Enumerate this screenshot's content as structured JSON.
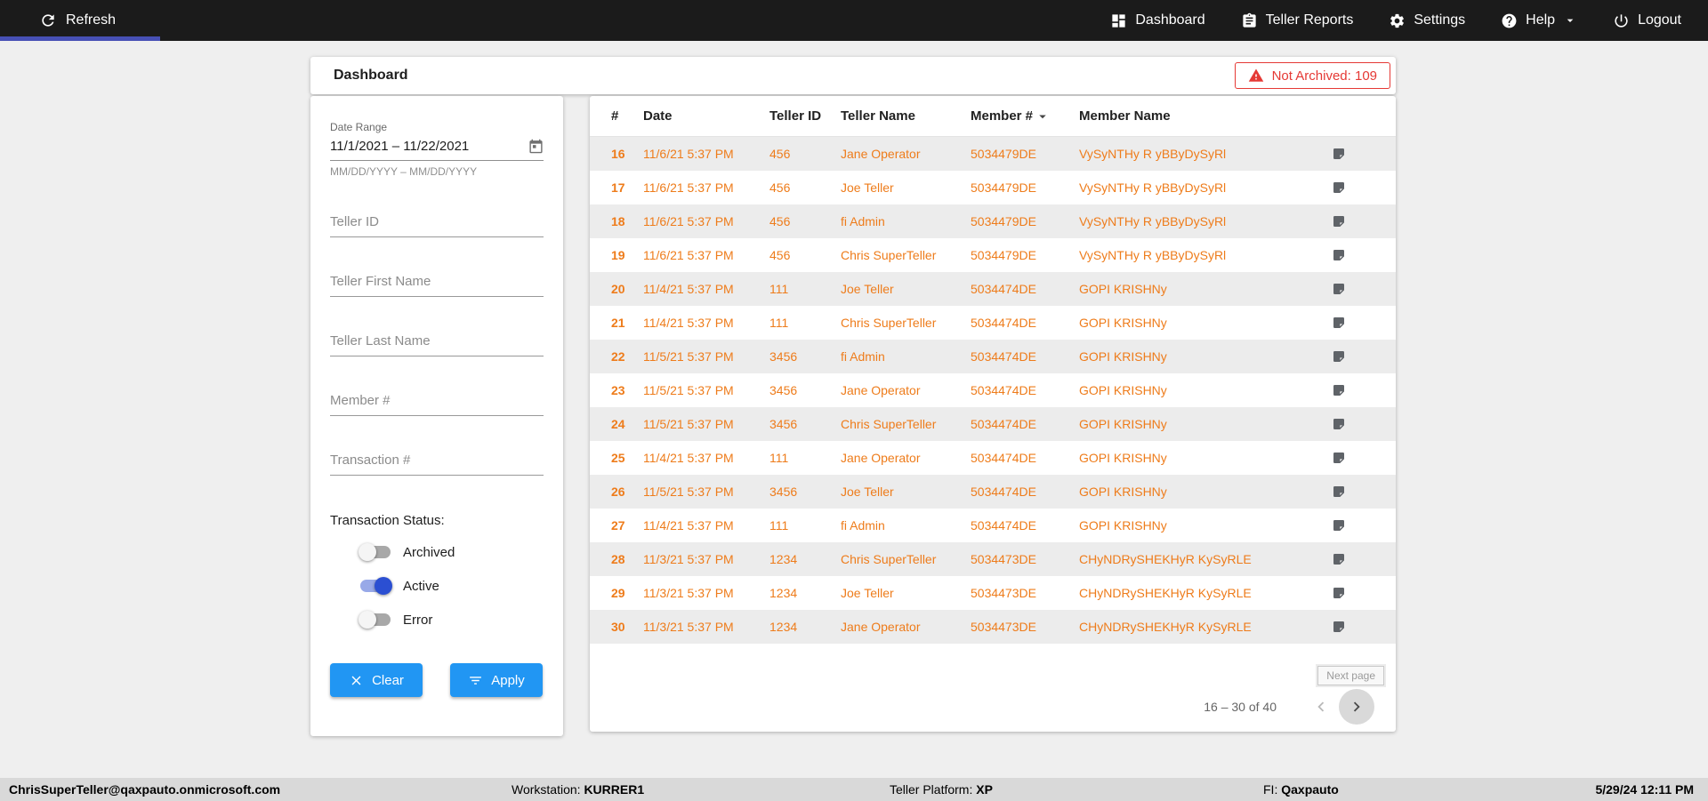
{
  "topbar": {
    "refresh_label": "Refresh",
    "nav": [
      {
        "label": "Dashboard"
      },
      {
        "label": "Teller Reports"
      },
      {
        "label": "Settings"
      },
      {
        "label": "Help"
      },
      {
        "label": "Logout"
      }
    ]
  },
  "header": {
    "title": "Dashboard",
    "not_archived": "Not Archived: 109"
  },
  "filters": {
    "date_range": {
      "label": "Date Range",
      "value": "11/1/2021 – 11/22/2021",
      "helper": "MM/DD/YYYY – MM/DD/YYYY"
    },
    "inputs": [
      {
        "placeholder": "Teller ID"
      },
      {
        "placeholder": "Teller First Name"
      },
      {
        "placeholder": "Teller Last Name"
      },
      {
        "placeholder": "Member #"
      },
      {
        "placeholder": "Transaction #"
      }
    ],
    "status": {
      "label": "Transaction Status:",
      "toggles": [
        {
          "label": "Archived",
          "on": false
        },
        {
          "label": "Active",
          "on": true
        },
        {
          "label": "Error",
          "on": false
        }
      ]
    },
    "clear_label": "Clear",
    "apply_label": "Apply"
  },
  "table": {
    "columns": [
      "#",
      "Date",
      "Teller ID",
      "Teller Name",
      "Member #",
      "Member Name"
    ],
    "rows": [
      {
        "num": "16",
        "date": "11/6/21 5:37 PM",
        "teller_id": "456",
        "teller_name": "Jane Operator",
        "member_num": "5034479DE",
        "member_name": "VySyNTHy R yBByDySyRl"
      },
      {
        "num": "17",
        "date": "11/6/21 5:37 PM",
        "teller_id": "456",
        "teller_name": "Joe Teller",
        "member_num": "5034479DE",
        "member_name": "VySyNTHy R yBByDySyRl"
      },
      {
        "num": "18",
        "date": "11/6/21 5:37 PM",
        "teller_id": "456",
        "teller_name": "fi Admin",
        "member_num": "5034479DE",
        "member_name": "VySyNTHy R yBByDySyRl"
      },
      {
        "num": "19",
        "date": "11/6/21 5:37 PM",
        "teller_id": "456",
        "teller_name": "Chris SuperTeller",
        "member_num": "5034479DE",
        "member_name": "VySyNTHy R yBByDySyRl"
      },
      {
        "num": "20",
        "date": "11/4/21 5:37 PM",
        "teller_id": "111",
        "teller_name": "Joe Teller",
        "member_num": "5034474DE",
        "member_name": "GOPI KRISHNy"
      },
      {
        "num": "21",
        "date": "11/4/21 5:37 PM",
        "teller_id": "111",
        "teller_name": "Chris SuperTeller",
        "member_num": "5034474DE",
        "member_name": "GOPI KRISHNy"
      },
      {
        "num": "22",
        "date": "11/5/21 5:37 PM",
        "teller_id": "3456",
        "teller_name": "fi Admin",
        "member_num": "5034474DE",
        "member_name": "GOPI KRISHNy"
      },
      {
        "num": "23",
        "date": "11/5/21 5:37 PM",
        "teller_id": "3456",
        "teller_name": "Jane Operator",
        "member_num": "5034474DE",
        "member_name": "GOPI KRISHNy"
      },
      {
        "num": "24",
        "date": "11/5/21 5:37 PM",
        "teller_id": "3456",
        "teller_name": "Chris SuperTeller",
        "member_num": "5034474DE",
        "member_name": "GOPI KRISHNy"
      },
      {
        "num": "25",
        "date": "11/4/21 5:37 PM",
        "teller_id": "111",
        "teller_name": "Jane Operator",
        "member_num": "5034474DE",
        "member_name": "GOPI KRISHNy"
      },
      {
        "num": "26",
        "date": "11/5/21 5:37 PM",
        "teller_id": "3456",
        "teller_name": "Joe Teller",
        "member_num": "5034474DE",
        "member_name": "GOPI KRISHNy"
      },
      {
        "num": "27",
        "date": "11/4/21 5:37 PM",
        "teller_id": "111",
        "teller_name": "fi Admin",
        "member_num": "5034474DE",
        "member_name": "GOPI KRISHNy"
      },
      {
        "num": "28",
        "date": "11/3/21 5:37 PM",
        "teller_id": "1234",
        "teller_name": "Chris SuperTeller",
        "member_num": "5034473DE",
        "member_name": "CHyNDRySHEKHyR KySyRLE"
      },
      {
        "num": "29",
        "date": "11/3/21 5:37 PM",
        "teller_id": "1234",
        "teller_name": "Joe Teller",
        "member_num": "5034473DE",
        "member_name": "CHyNDRySHEKHyR KySyRLE"
      },
      {
        "num": "30",
        "date": "11/3/21 5:37 PM",
        "teller_id": "1234",
        "teller_name": "Jane Operator",
        "member_num": "5034473DE",
        "member_name": "CHyNDRySHEKHyR KySyRLE"
      }
    ],
    "pagination": {
      "range": "16 – 30 of 40",
      "next_tooltip": "Next page"
    }
  },
  "footer": {
    "email": "ChrisSuperTeller@qaxpauto.onmicrosoft.com",
    "workstation_label": "Workstation:",
    "workstation_value": "KURRER1",
    "platform_label": "Teller Platform:",
    "platform_value": "XP",
    "fi_label": "FI:",
    "fi_value": "Qaxpauto",
    "datetime": "5/29/24 12:11 PM"
  },
  "colors": {
    "accent_blue": "#2196f3",
    "nav_indicator": "#4750b5",
    "row_text_orange": "#ee7c1b",
    "alert_red": "#e53935",
    "toggle_on_blue": "#2b4fd2"
  }
}
